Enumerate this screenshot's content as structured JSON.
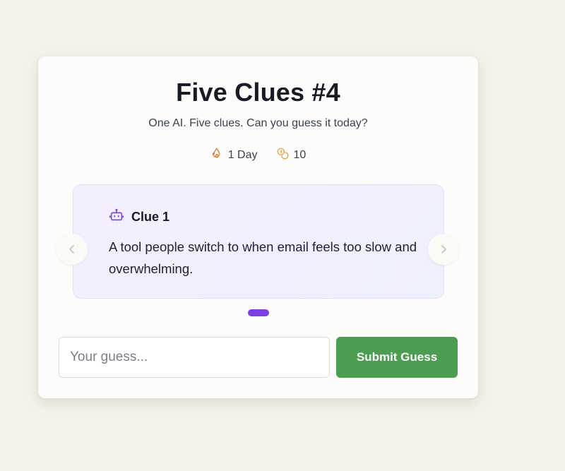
{
  "game": {
    "title": "Five Clues #4",
    "subtitle": "One AI. Five clues. Can you guess it today?"
  },
  "stats": {
    "streak": {
      "icon": "flame-icon",
      "value": "1 Day",
      "color": "#e07b39"
    },
    "coins": {
      "icon": "coins-icon",
      "value": "10",
      "color": "#e0a23a"
    }
  },
  "clue": {
    "icon": "robot-icon",
    "label": "Clue 1",
    "text": "A tool people switch to when email feels too slow and overwhelming."
  },
  "carousel": {
    "prev_icon": "chevron-left-icon",
    "next_icon": "chevron-right-icon",
    "active_index": 1,
    "visible_dots": 1
  },
  "guess": {
    "placeholder": "Your guess...",
    "value": "",
    "submit_label": "Submit Guess"
  },
  "colors": {
    "accent_purple": "#7b3fe4",
    "submit_green": "#4c9d51",
    "background": "#f4f1e9"
  }
}
